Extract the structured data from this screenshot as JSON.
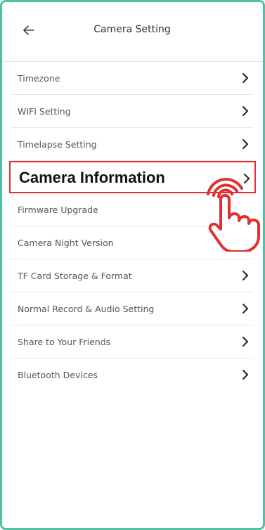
{
  "header": {
    "title": "Camera Setting",
    "back_icon": "arrow-left-icon"
  },
  "settings": {
    "items": [
      {
        "label": "Timezone"
      },
      {
        "label": "WIFI Setting"
      },
      {
        "label": "Timelapse Setting"
      },
      {
        "label": "Camera Information",
        "highlighted": true
      },
      {
        "label": "Firmware Upgrade"
      },
      {
        "label": "Camera Night Version"
      },
      {
        "label": "TF Card Storage & Format"
      },
      {
        "label": "Normal Record & Audio Setting"
      },
      {
        "label": "Share to Your Friends"
      },
      {
        "label": "Bluetooth Devices"
      }
    ]
  },
  "colors": {
    "frame_border": "#4fc3a1",
    "highlight_border": "#e03030",
    "tap_hand": "#e03030"
  },
  "overlay": {
    "icon": "tap-hand-icon"
  }
}
